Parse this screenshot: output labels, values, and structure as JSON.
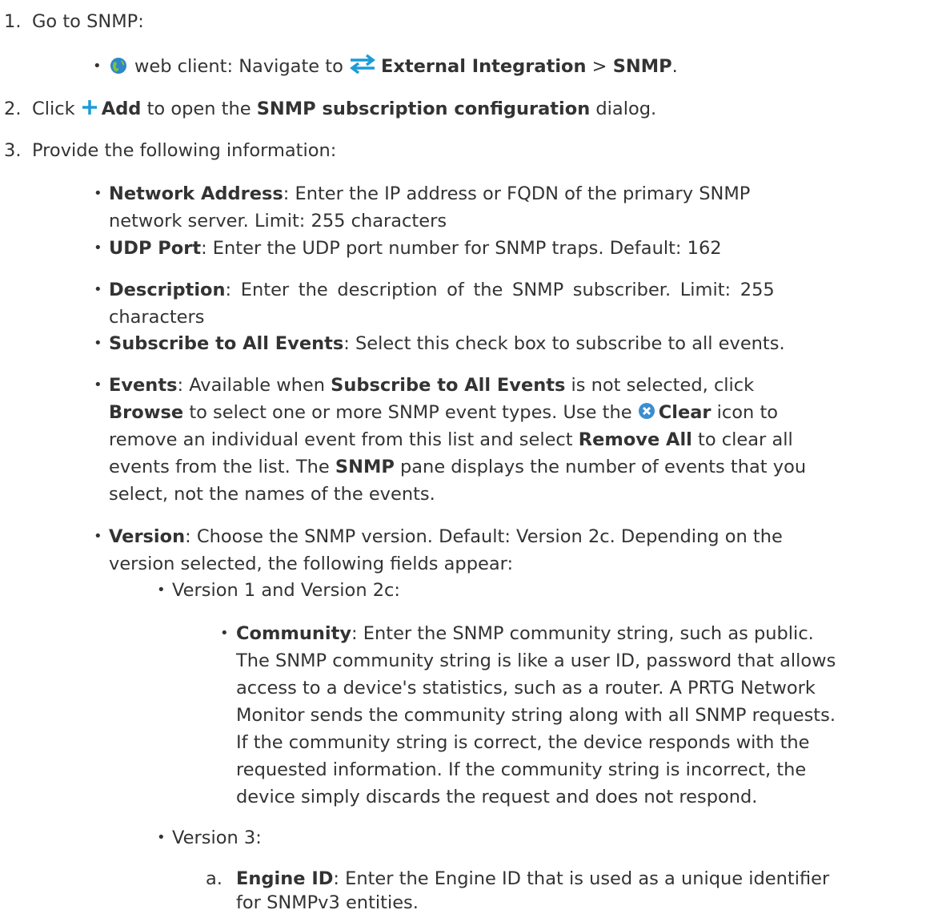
{
  "steps": {
    "s1": {
      "num": "1.",
      "text": "Go to SNMP:"
    },
    "s1_sub": {
      "text_a": "web client: Navigate to",
      "link_ext": "External Integration",
      "sep": ">",
      "link_snmp": "SNMP",
      "end": "."
    },
    "s2": {
      "num": "2.",
      "text_a": "Click",
      "add": "Add",
      "text_b": "to open the",
      "dialog": "SNMP subscription configuration",
      "text_c": "dialog."
    },
    "s3": {
      "num": "3.",
      "text": "Provide the following information:"
    }
  },
  "fields": {
    "network_address": {
      "label": "Network Address",
      "line1": ": Enter the IP address or FQDN of the primary SNMP",
      "line2": "network server. Limit: 255 characters"
    },
    "udp_port": {
      "label": "UDP Port",
      "text": ": Enter the UDP port number for SNMP traps. Default: 162"
    },
    "description": {
      "label": "Description",
      "line1": ": Enter the description of the SNMP subscriber. Limit: 255",
      "line2": "characters"
    },
    "subscribe_all": {
      "label": "Subscribe to All Events",
      "text": ": Select this check box to subscribe to all events."
    },
    "events": {
      "label": "Events",
      "l1a": ": Available when",
      "l1b": "Subscribe to All Events",
      "l1c": "is not selected, click",
      "l2a": "Browse",
      "l2b": "to select one or more SNMP event types. Use the",
      "l2c": "Clear",
      "l2d": "icon to",
      "l3a": "remove an individual event from this list and select",
      "l3b": "Remove All",
      "l3c": "to clear all",
      "l4a": "events from the list. The",
      "l4b": "SNMP",
      "l4c": "pane displays the number of events that you",
      "l5": "select, not the names of the events."
    },
    "version": {
      "label": "Version",
      "line1": ": Choose the SNMP version. Default: Version 2c. Depending on the",
      "line2": "version selected, the following fields appear:",
      "v12": {
        "label": "Version 1 and Version 2c:",
        "community": {
          "label": "Community",
          "line1": ": Enter the SNMP community string, such as public.",
          "line2": "The SNMP community string is like a user ID, password that allows",
          "line3": "access to a device's statistics, such as a router. A PRTG Network",
          "line4": "Monitor sends the community string along with all SNMP requests.",
          "line5": "If the community string is correct, the device responds with the",
          "line6": "requested information. If the community string is incorrect, the",
          "line7": "device simply discards the request and does not respond."
        }
      },
      "v3": {
        "label": "Version 3:",
        "engine_id": {
          "marker": "a.",
          "label": "Engine ID",
          "line1": ": Enter the Engine ID that is used as a unique identifier",
          "line2": "for SNMPv3 entities."
        }
      }
    }
  },
  "icon_names": [
    "globe-icon",
    "swap-arrows-icon",
    "plus-icon",
    "clear-icon"
  ],
  "colors": {
    "text": "#333333",
    "accent": "#1a9cd8",
    "clear_icon": "#3b8ed0"
  }
}
